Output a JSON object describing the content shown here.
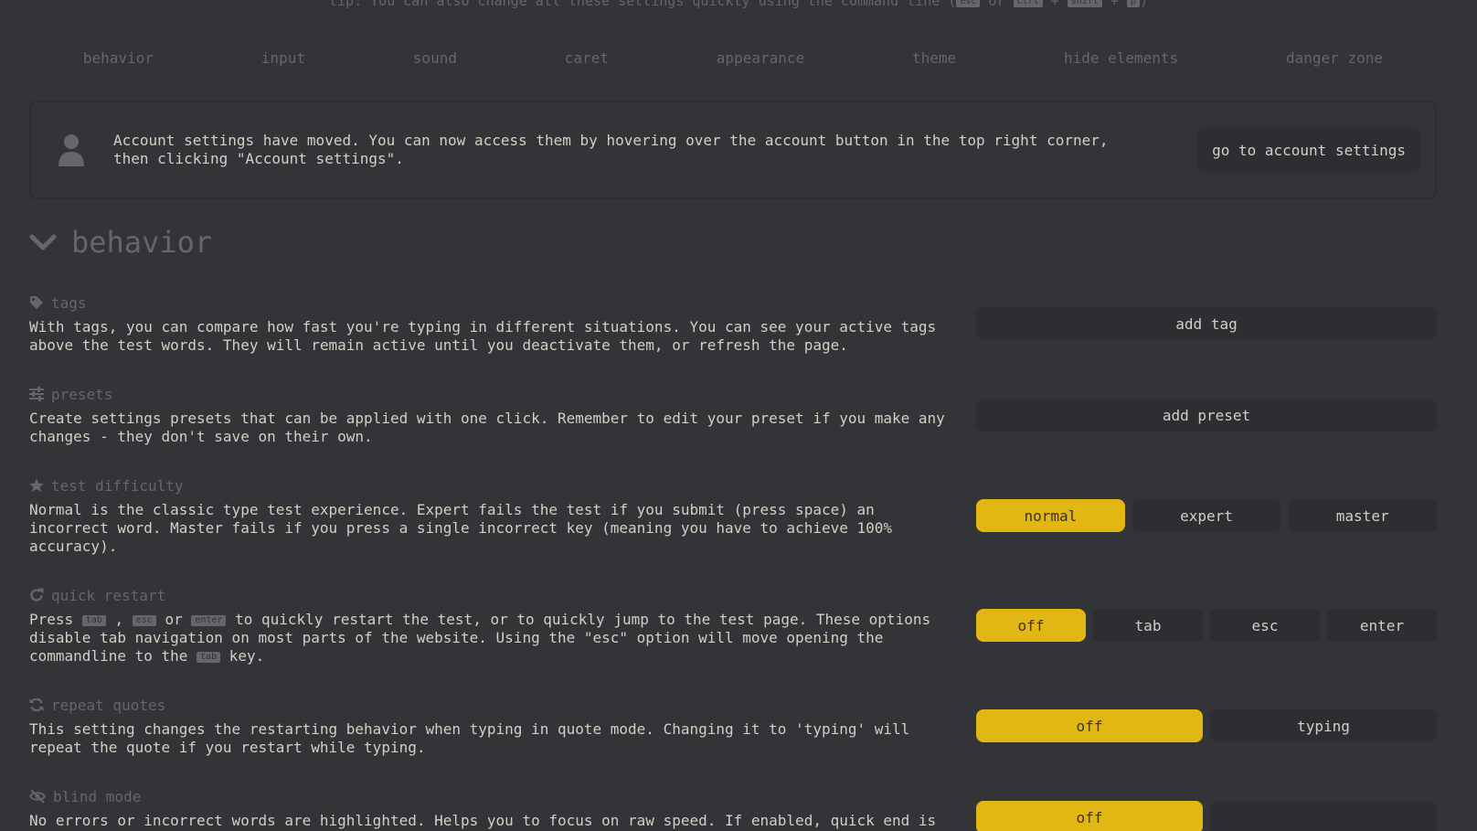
{
  "tip": {
    "prefix": "tip: You can also change all these settings quickly using the command line (",
    "key1": "esc",
    "or": " or ",
    "key2": "ctrl",
    "plus1": " + ",
    "key3": "shift",
    "plus2": " + ",
    "key4": "p",
    "suffix": ")"
  },
  "nav": [
    "behavior",
    "input",
    "sound",
    "caret",
    "appearance",
    "theme",
    "hide elements",
    "danger zone"
  ],
  "notice": {
    "icon": "user-icon",
    "text": "Account settings have moved. You can now access them by hovering over the account button in the top right corner, then clicking \"Account settings\".",
    "button": "go to account settings"
  },
  "section": {
    "title": "behavior",
    "icon": "chevron-down-icon"
  },
  "settings": {
    "tags": {
      "icon": "tag-icon",
      "title": "tags",
      "desc": "With tags, you can compare how fast you're typing in different situations. You can see your active tags above the test words. They will remain active until you deactivate them, or refresh the page.",
      "button": "add tag"
    },
    "presets": {
      "icon": "sliders-icon",
      "title": "presets",
      "desc": "Create settings presets that can be applied with one click. Remember to edit your preset if you make any changes - they don't save on their own.",
      "button": "add preset"
    },
    "difficulty": {
      "icon": "star-icon",
      "title": "test difficulty",
      "desc": "Normal is the classic type test experience. Expert fails the test if you submit (press space) an incorrect word. Master fails if you press a single incorrect key (meaning you have to achieve 100% accuracy).",
      "options": [
        "normal",
        "expert",
        "master"
      ],
      "selected": "normal"
    },
    "quick_restart": {
      "icon": "redo-icon",
      "title": "quick restart",
      "desc_press": "Press ",
      "key_tab": "tab",
      "comma": " , ",
      "key_esc": "esc",
      "or": " or ",
      "key_enter": "enter",
      "desc_mid": " to quickly restart the test, or to quickly jump to the test page. These options disable tab navigation on most parts of the website. Using the \"esc\" option will move opening the commandline to the ",
      "key_tab2": "tab",
      "desc_end": " key.",
      "options": [
        "off",
        "tab",
        "esc",
        "enter"
      ],
      "selected": "off"
    },
    "repeat_quotes": {
      "icon": "sync-icon",
      "title": "repeat quotes",
      "desc": "This setting changes the restarting behavior when typing in quote mode. Changing it to 'typing' will repeat the quote if you restart while typing.",
      "options": [
        "off",
        "typing"
      ],
      "selected": "off"
    },
    "blind_mode": {
      "icon": "eye-slash-icon",
      "title": "blind mode",
      "desc": "No errors or incorrect words are highlighted. Helps you to focus on raw speed. If enabled, quick end is",
      "options": [
        "off",
        ""
      ],
      "selected": "off"
    }
  },
  "colors": {
    "background": "#323437",
    "sub": "#646669",
    "text": "#d1d0c5",
    "accent": "#e2b714",
    "button_bg": "#2c2e31"
  }
}
